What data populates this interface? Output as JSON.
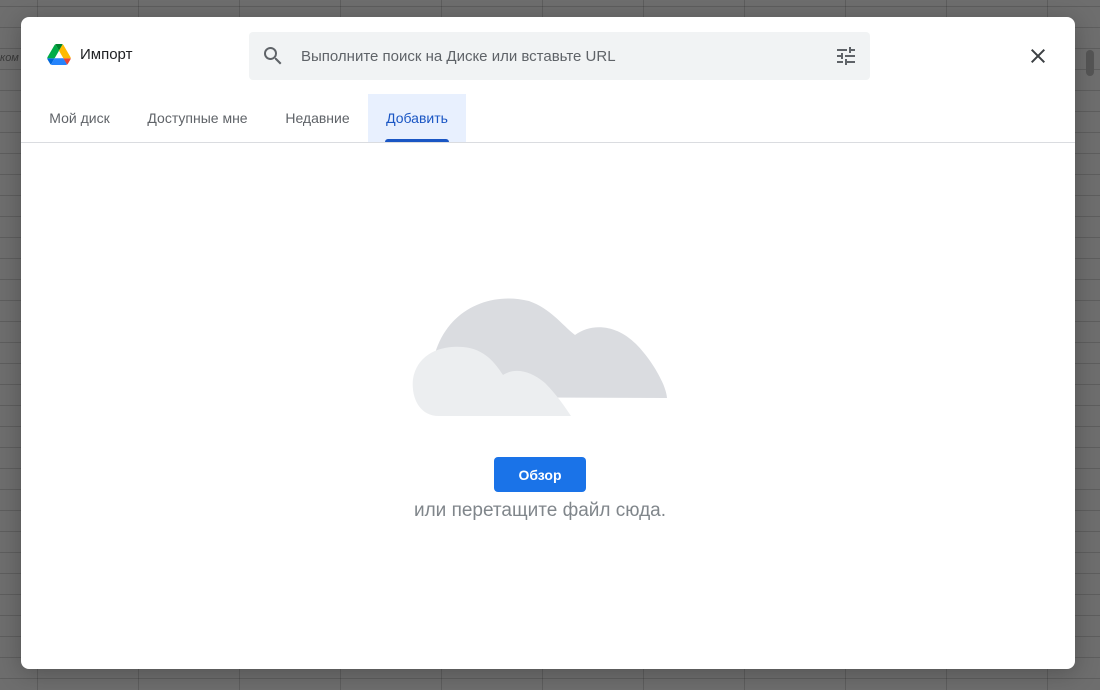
{
  "background": {
    "cell_text": "ком"
  },
  "dialog": {
    "title": "Импорт",
    "search": {
      "placeholder": "Выполните поиск на Диске или вставьте URL"
    },
    "icons": {
      "logo": "google-drive-icon",
      "search": "search-icon",
      "filter": "tune-icon",
      "close": "close-icon"
    },
    "tabs": [
      {
        "label": "Мой диск",
        "active": false
      },
      {
        "label": "Доступные мне",
        "active": false
      },
      {
        "label": "Недавние",
        "active": false
      },
      {
        "label": "Добавить",
        "active": true
      }
    ],
    "upload": {
      "browse_label": "Обзор",
      "hint": "или перетащите файл сюда."
    }
  },
  "colors": {
    "accent": "#1a73e8",
    "active_tab_bg": "#e8f0fe",
    "active_tab_text": "#1a56c4"
  }
}
